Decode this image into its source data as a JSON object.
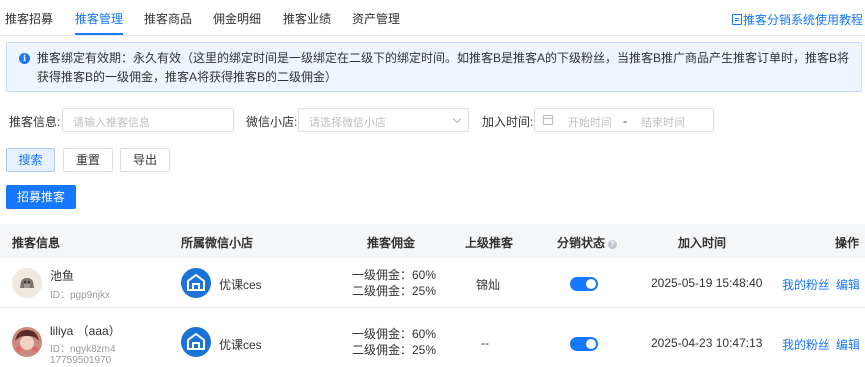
{
  "tabs": [
    {
      "label": "推客招募"
    },
    {
      "label": "推客管理",
      "active": true
    },
    {
      "label": "推客商品"
    },
    {
      "label": "佣金明细"
    },
    {
      "label": "推客业绩"
    },
    {
      "label": "资产管理"
    }
  ],
  "doc_link": "推客分销系统使用教程",
  "notice": {
    "icon": "info-icon",
    "text": "推客绑定有效期：永久有效（这里的绑定时间是一级绑定在二级下的绑定时间。如推客B是推客A的下级粉丝，当推客B推广商品产生推客订单时，推客B将获得推客B的一级佣金，推客A将获得推客B的二级佣金）"
  },
  "filters": {
    "info_label": "推客信息:",
    "info_placeholder": "请输入推客信息",
    "shop_label": "微信小店:",
    "shop_placeholder": "请选择微信小店",
    "time_label": "加入时间:",
    "start_placeholder": "开始时间",
    "range_separator": "-",
    "end_placeholder": "结束时间"
  },
  "buttons": {
    "search": "搜索",
    "reset": "重置",
    "export": "导出",
    "recruit": "招募推客"
  },
  "table": {
    "headers": {
      "info": "推客信息",
      "shop": "所属微信小店",
      "commission": "推客佣金",
      "upper": "上级推客",
      "status": "分销状态",
      "join_time": "加入时间",
      "actions": "操作"
    },
    "rows": [
      {
        "name": "池鱼",
        "id_text": "ID：pgp9njkx",
        "phone": "",
        "shop": "优课ces",
        "level1": "一级佣金：60%",
        "level2": "二级佣金：25%",
        "upper": "锦灿",
        "status_on": true,
        "join_time": "2025-05-19 15:48:40",
        "fans_link": "我的粉丝",
        "edit_link": "编辑"
      },
      {
        "name": "liliya （aaa）",
        "id_text": "ID：ngyk8zm4",
        "phone": "17759501970",
        "shop": "优课ces",
        "level1": "一级佣金：60%",
        "level2": "二级佣金：25%",
        "upper": "--",
        "status_on": true,
        "join_time": "2025-04-23 10:47:13",
        "fans_link": "我的粉丝",
        "edit_link": "编辑"
      }
    ]
  },
  "colors": {
    "accent": "#1677ff",
    "notice_bg": "#eef5ff",
    "header_bg": "#f5f6f8",
    "shop_icon": "#1a73d9"
  }
}
